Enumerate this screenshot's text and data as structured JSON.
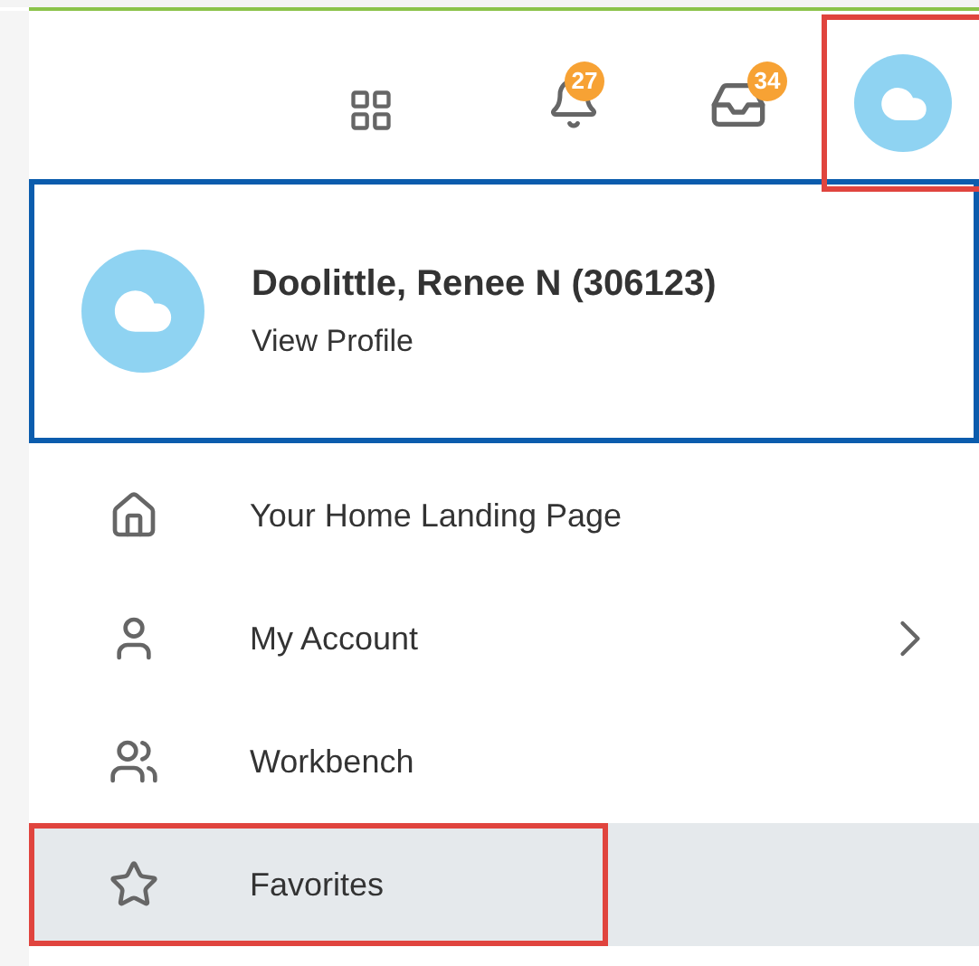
{
  "header": {
    "notifications": {
      "count": "27"
    },
    "inbox": {
      "count": "34"
    },
    "avatar": {
      "highlighted": true
    }
  },
  "profile": {
    "name": "Doolittle, Renee N (306123)",
    "link": "View Profile",
    "focused": true
  },
  "menu": [
    {
      "label": "Your Home Landing Page",
      "kind": "home",
      "has_submenu": false,
      "selected": false,
      "highlighted": false
    },
    {
      "label": "My Account",
      "kind": "account",
      "has_submenu": true,
      "selected": false,
      "highlighted": false
    },
    {
      "label": "Workbench",
      "kind": "workbench",
      "has_submenu": false,
      "selected": false,
      "highlighted": false
    },
    {
      "label": "Favorites",
      "kind": "favorites",
      "has_submenu": false,
      "selected": true,
      "highlighted": true
    }
  ]
}
